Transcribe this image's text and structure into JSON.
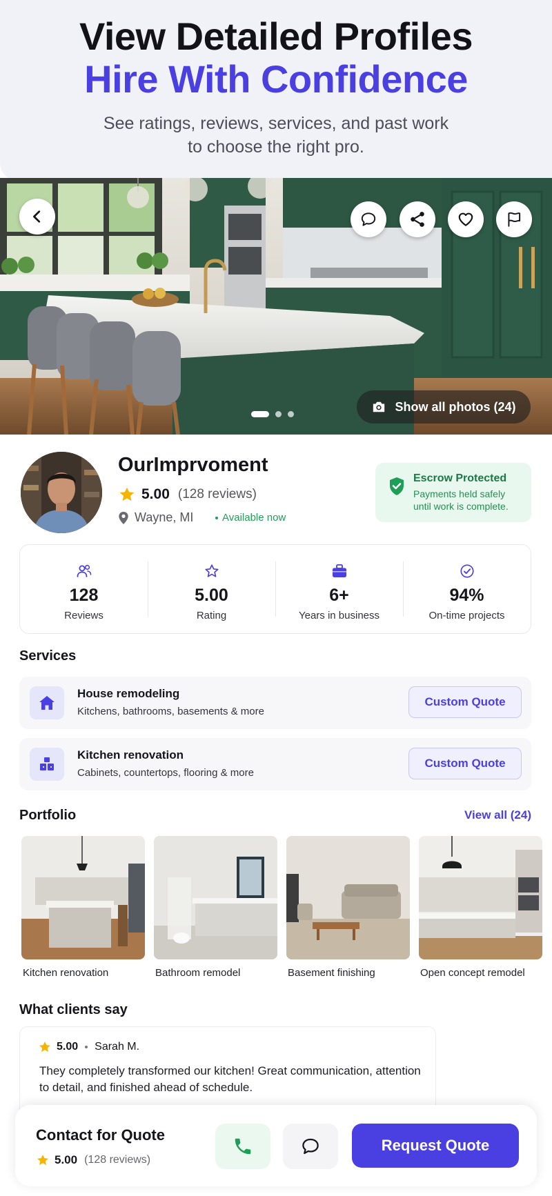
{
  "hero": {
    "title_line1": "View Detailed Profiles",
    "title_line2": "Hire With Confidence",
    "subtitle_line1": "See ratings, reviews, services, and past work",
    "subtitle_line2": "to choose the right pro."
  },
  "gallery": {
    "show_all_label": "Show all photos (24)",
    "dot_count": 3,
    "active_dot": 0,
    "icons": [
      "chevron-left-icon",
      "chat-bubble-icon",
      "share-icon",
      "heart-icon",
      "flag-icon",
      "camera-icon"
    ]
  },
  "profile": {
    "name": "OurImprvoment",
    "rating": "5.00",
    "review_count": "(128 reviews)",
    "location": "Wayne, MI",
    "availability": "Available now"
  },
  "escrow": {
    "title": "Escrow Protected",
    "line1": "Payments held safely",
    "line2": "until work is complete."
  },
  "stats": [
    {
      "value": "128",
      "label": "Reviews",
      "icon": "users-icon"
    },
    {
      "value": "5.00",
      "label": "Rating",
      "icon": "star-outline-icon"
    },
    {
      "value": "6+",
      "label": "Years in business",
      "icon": "briefcase-icon"
    },
    {
      "value": "94%",
      "label": "On-time projects",
      "icon": "check-circle-icon"
    }
  ],
  "services": {
    "title": "Services",
    "items": [
      {
        "name": "House remodeling",
        "description": "Kitchens, bathrooms, basements & more",
        "button": "Custom Quote",
        "icon": "house-icon"
      },
      {
        "name": "Kitchen renovation",
        "description": "Cabinets, countertops, flooring & more",
        "button": "Custom Quote",
        "icon": "boxes-icon"
      }
    ]
  },
  "portfolio": {
    "title": "Portfolio",
    "view_all": "View all (24)",
    "items": [
      {
        "caption": "Kitchen renovation"
      },
      {
        "caption": "Bathroom remodel"
      },
      {
        "caption": "Basement finishing"
      },
      {
        "caption": "Open concept remodel"
      }
    ]
  },
  "reviews": {
    "title": "What clients say",
    "items": [
      {
        "rating": "5.00",
        "author": "Sarah M.",
        "text": "They completely transformed our kitchen! Great communication, attention to detail, and finished ahead of schedule."
      }
    ]
  },
  "bottom_bar": {
    "title": "Contact for Quote",
    "rating": "5.00",
    "review_count": "(128 reviews)",
    "request_label": "Request Quote"
  },
  "colors": {
    "accent": "#4a3fe0",
    "success": "#1f9e57",
    "star": "#f5b400"
  }
}
